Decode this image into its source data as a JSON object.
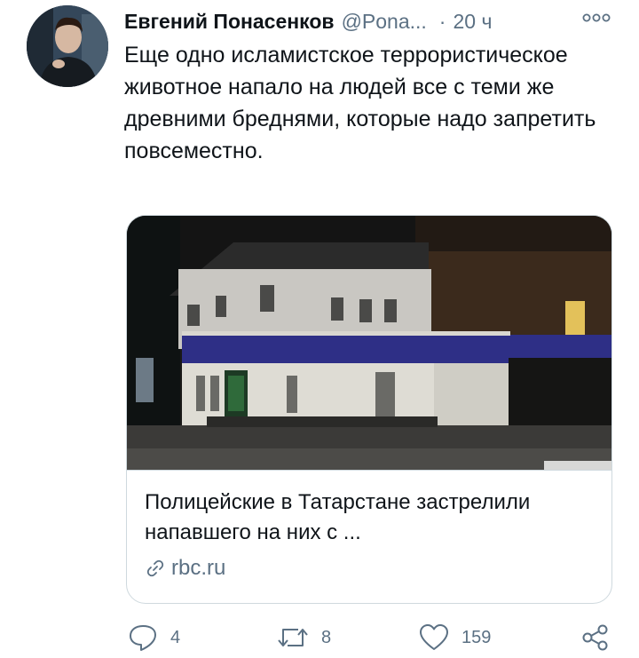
{
  "tweet": {
    "author_name": "Евгений Понасенков",
    "author_handle": "@Pona...",
    "separator": "·",
    "time": "20 ч",
    "text": "Еще одно исламистское террористическое животное напало на людей все с теми же древними бреднями, которые надо запретить повсеместно."
  },
  "card": {
    "title": "Полицейские в Татарстане застрелили напавшего на них с ...",
    "domain": "rbc.ru",
    "icon": "link-icon"
  },
  "actions": {
    "reply_count": "4",
    "retweet_count": "8",
    "like_count": "159"
  },
  "colors": {
    "secondary_text": "#5b7083",
    "border": "#cfd9de",
    "primary_text": "#0f1419"
  }
}
